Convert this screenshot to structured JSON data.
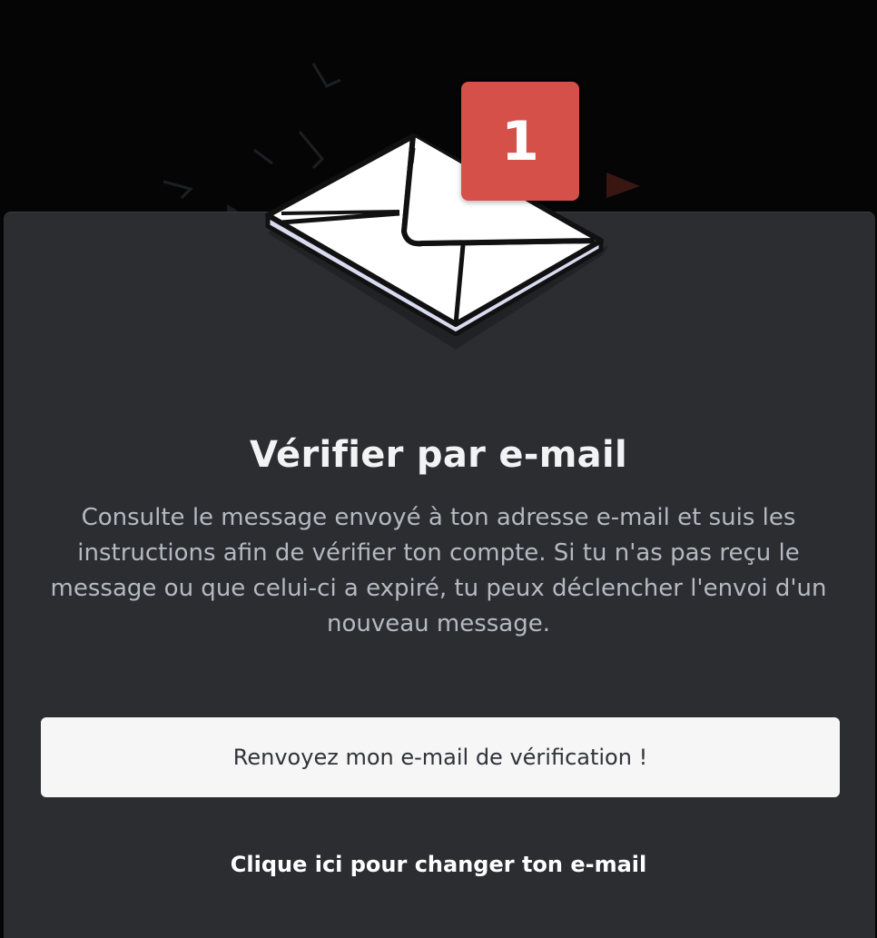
{
  "illustration": {
    "icon": "envelope-icon",
    "badge_count": "1",
    "badge_color": "#d6504a"
  },
  "modal": {
    "title": "Vérifier par e-mail",
    "description": "Consulte le message envoyé à ton adresse e-mail et suis les instructions afin de vérifier ton compte. Si tu n'as pas reçu le message ou que celui-ci a expiré, tu peux déclencher l'envoi d'un nouveau message.",
    "resend_button_label": "Renvoyez mon e-mail de vérification !",
    "change_email_link": "Clique ici pour changer ton e-mail",
    "background_color": "#2b2d31"
  }
}
